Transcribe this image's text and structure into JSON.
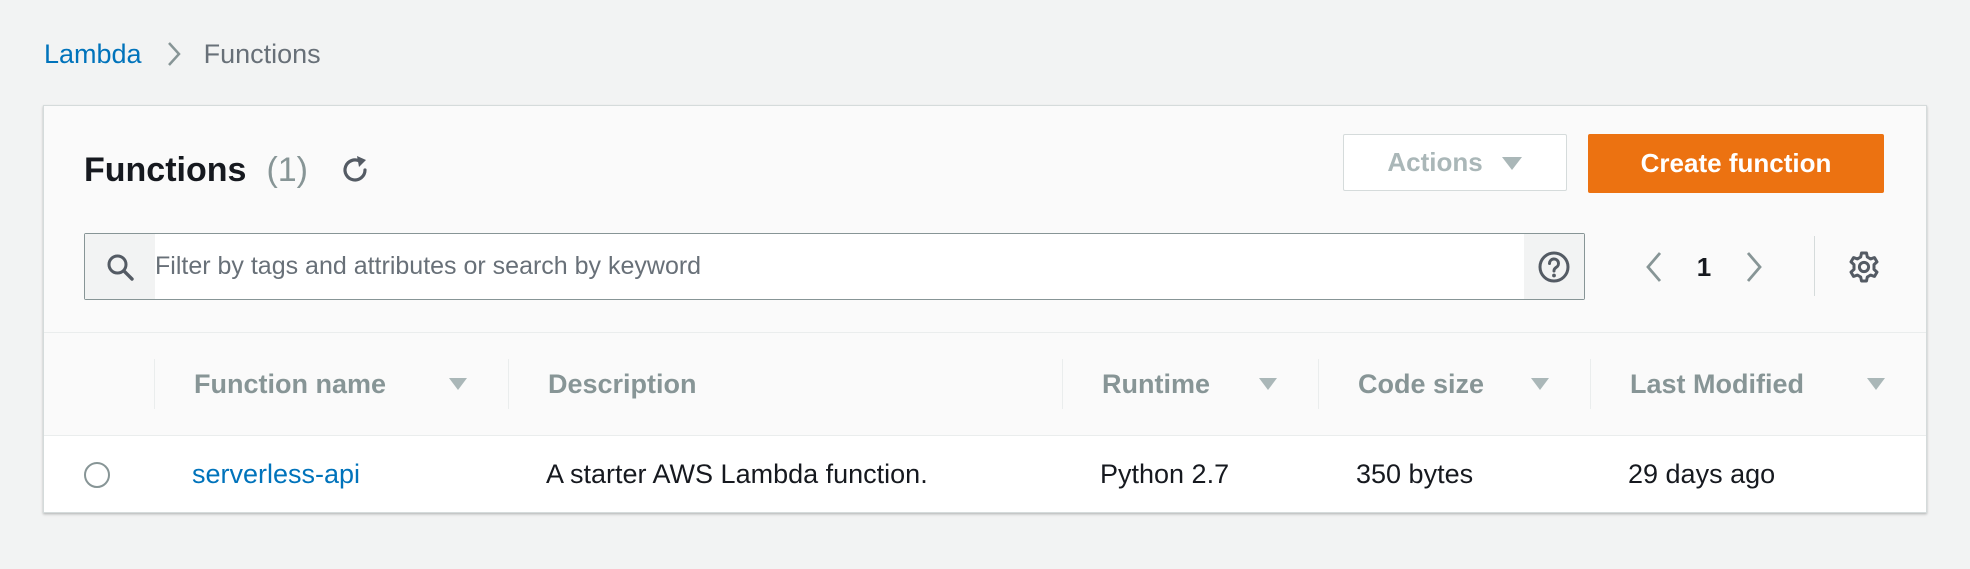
{
  "breadcrumb": {
    "parent": "Lambda",
    "current": "Functions"
  },
  "header": {
    "title": "Functions",
    "count": "(1)",
    "actions_label": "Actions",
    "create_label": "Create function"
  },
  "search": {
    "placeholder": "Filter by tags and attributes or search by keyword",
    "value": ""
  },
  "pagination": {
    "current_page": "1"
  },
  "table": {
    "columns": [
      {
        "label": "Function name"
      },
      {
        "label": "Description"
      },
      {
        "label": "Runtime"
      },
      {
        "label": "Code size"
      },
      {
        "label": "Last Modified"
      }
    ],
    "rows": [
      {
        "function_name": "serverless-api",
        "description": "A starter AWS Lambda function.",
        "runtime": "Python 2.7",
        "code_size": "350 bytes",
        "last_modified": "29 days ago"
      }
    ]
  },
  "colors": {
    "page_background": "#f2f3f3",
    "link": "#0073bb",
    "primary_button": "#ec7211",
    "muted_text": "#879596"
  },
  "icons": {
    "breadcrumb_separator": "chevron-right-icon",
    "refresh": "refresh-icon",
    "actions_caret": "caret-down-icon",
    "search": "search-icon",
    "help": "help-circle-icon",
    "prev": "chevron-left-icon",
    "next": "chevron-right-icon",
    "settings": "gear-icon",
    "sort": "sort-caret-icon"
  }
}
